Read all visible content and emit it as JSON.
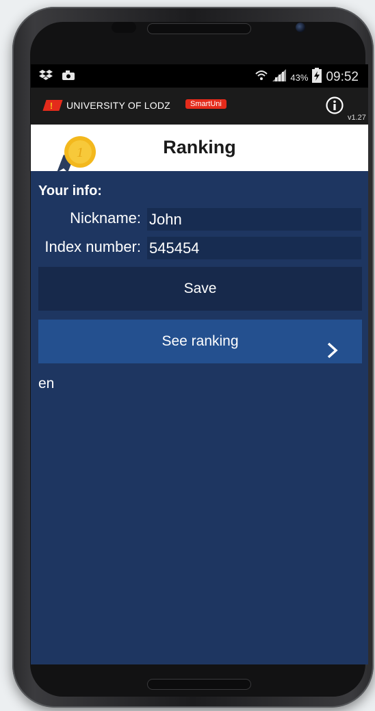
{
  "status_bar": {
    "battery_percent": "43%",
    "time": "09:52",
    "icons": [
      "dropbox-icon",
      "camera-icon",
      "wifi-icon",
      "signal-icon",
      "battery-icon"
    ]
  },
  "header": {
    "org_name": "UNIVERSITY OF LODZ",
    "app_badge": "SmartUni",
    "version": "v1.27",
    "colors": {
      "badge": "#e42b1b",
      "header_bg": "#1b1b1b"
    }
  },
  "page": {
    "title": "Ranking",
    "icon": "medal-icon"
  },
  "your_info": {
    "section_title": "Your info:",
    "nickname_label": "Nickname:",
    "nickname_value": "John",
    "index_label": "Index number:",
    "index_value": "545454"
  },
  "actions": {
    "save_label": "Save",
    "see_ranking_label": "See ranking"
  },
  "language": "en",
  "colors": {
    "screen_bg": "#1e3661",
    "save_bg": "#17294b",
    "ranking_bg": "#24508f"
  }
}
